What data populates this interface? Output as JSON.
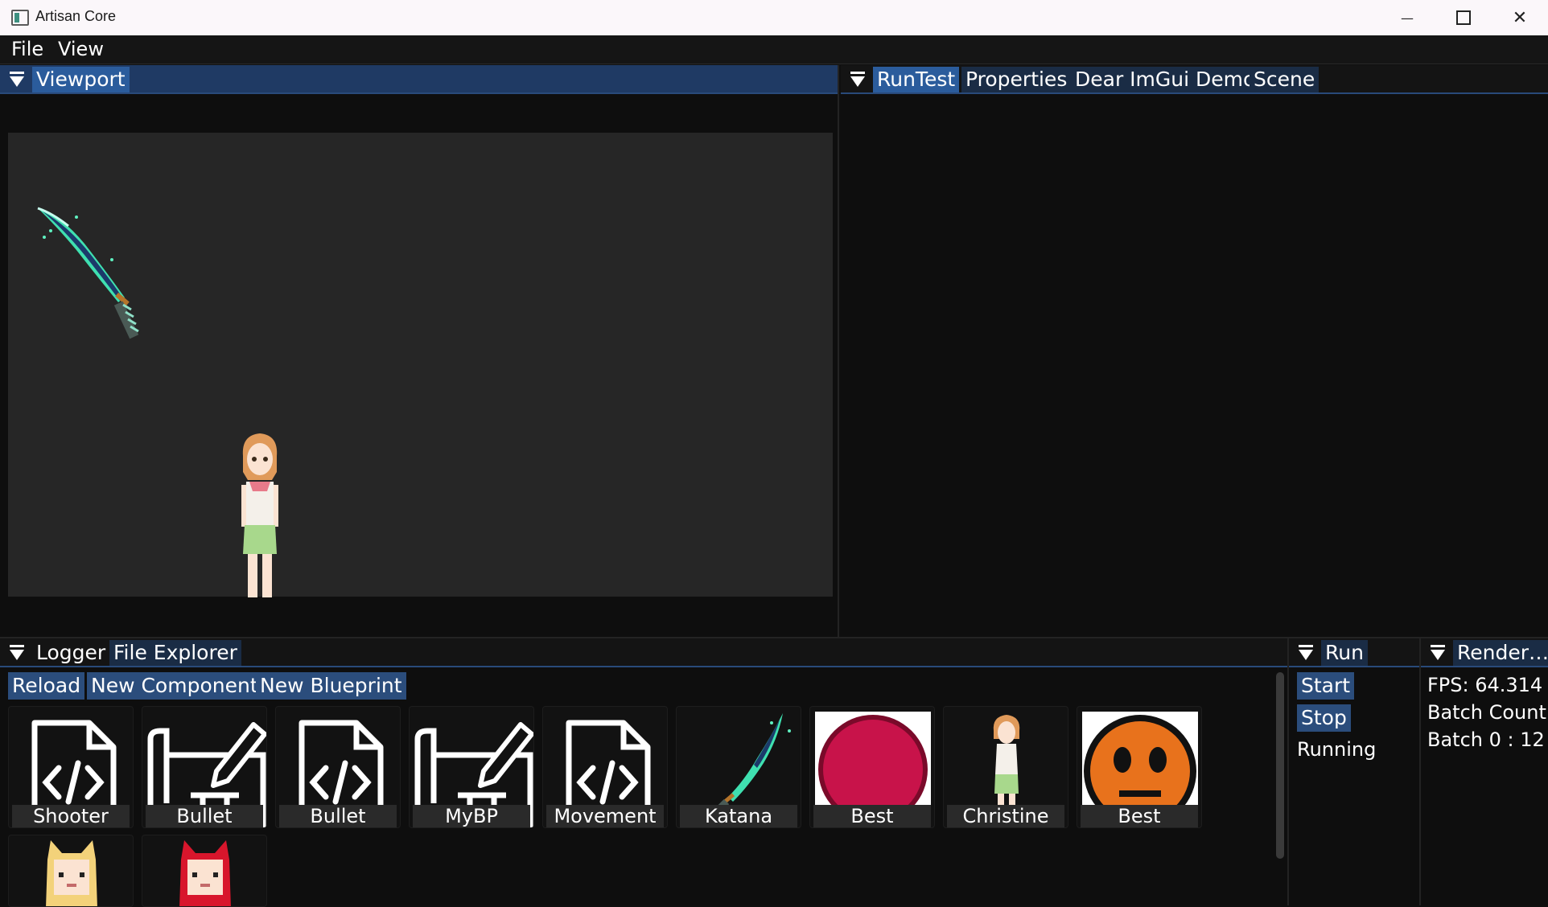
{
  "window": {
    "title": "Artisan Core",
    "controls": {
      "minimize": "—",
      "close": "✕"
    }
  },
  "menubar": {
    "file": "File",
    "view": "View"
  },
  "viewport_dock": {
    "tab": "Viewport"
  },
  "right_dock": {
    "tabs": [
      "RunTest",
      "Properties",
      "Dear ImGui Demo",
      "Scene"
    ]
  },
  "bottom_dock": {
    "tabs": [
      "Logger",
      "File Explorer"
    ],
    "buttons": {
      "reload": "Reload",
      "new_component": "New Component",
      "new_blueprint": "New Blueprint"
    },
    "files": [
      {
        "label": "Shooter",
        "icon": "code-file-icon"
      },
      {
        "label": "Bullet",
        "icon": "blueprint-icon"
      },
      {
        "label": "Bullet",
        "icon": "code-file-icon"
      },
      {
        "label": "MyBP",
        "icon": "blueprint-icon"
      },
      {
        "label": "Movement",
        "icon": "code-file-icon"
      },
      {
        "label": "Katana",
        "icon": "katana-sprite"
      },
      {
        "label": "Best",
        "icon": "red-circle-sprite"
      },
      {
        "label": "Christine",
        "icon": "character-sprite"
      },
      {
        "label": "Best",
        "icon": "orange-face-sprite"
      },
      {
        "label": "",
        "icon": "blonde-cat-girl-sprite"
      },
      {
        "label": "",
        "icon": "red-cat-girl-sprite"
      }
    ]
  },
  "run_dock": {
    "tab": "Run",
    "start": "Start",
    "stop": "Stop",
    "status": "Running"
  },
  "render_dock": {
    "tab": "Render…",
    "fps": "FPS: 64.314",
    "batch_count": "Batch Count",
    "batch0": "Batch 0 : 12"
  },
  "colors": {
    "accent": "#2b5c9c",
    "tab_inactive": "#1a2c45",
    "panel_bg": "#0e0e0e",
    "viewport_bg": "#262626"
  }
}
